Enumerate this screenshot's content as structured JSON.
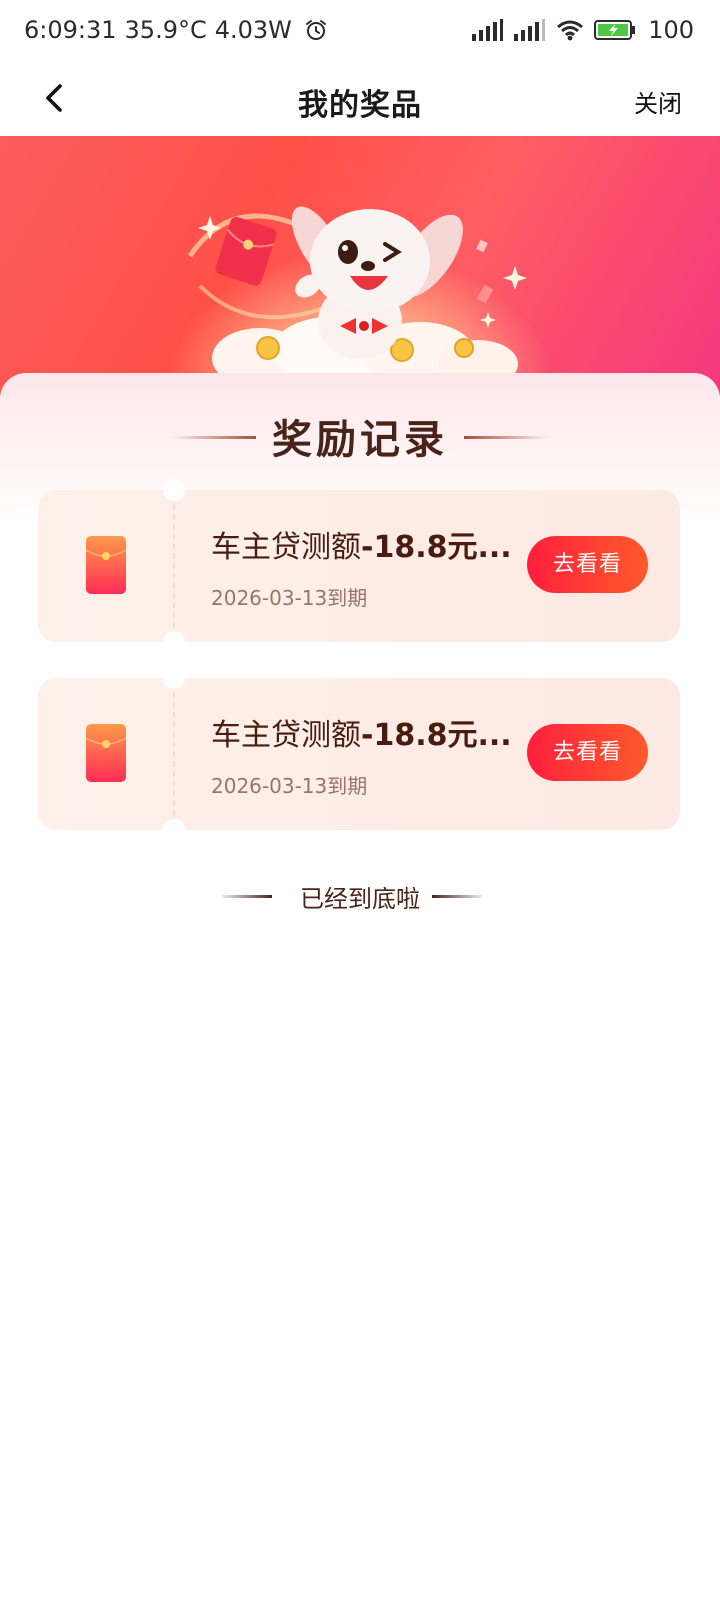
{
  "status_bar": {
    "time": "6:09:31",
    "temperature": "35.9°C",
    "power": "4.03W",
    "battery": "100",
    "icons": [
      "alarm-icon",
      "signal-icon",
      "signal-icon",
      "wifi-icon",
      "battery-charging-icon"
    ]
  },
  "nav": {
    "title": "我的奖品",
    "close_label": "关闭",
    "back_icon": "chevron-left-icon"
  },
  "section": {
    "title": "奖励记录"
  },
  "prizes": [
    {
      "title_normal": "车主贷测额",
      "title_bold": "-18.8元...",
      "expiry": "2026-03-13到期",
      "button_label": "去看看",
      "icon": "red-envelope-icon"
    },
    {
      "title_normal": "车主贷测额",
      "title_bold": "-18.8元...",
      "expiry": "2026-03-13到期",
      "button_label": "去看看",
      "icon": "red-envelope-icon"
    }
  ],
  "footer": {
    "end_tip": "已经到底啦"
  },
  "colors": {
    "accent": "#ff2d3f",
    "title_brown": "#4a2318",
    "card_bg": "#fdefe8"
  }
}
